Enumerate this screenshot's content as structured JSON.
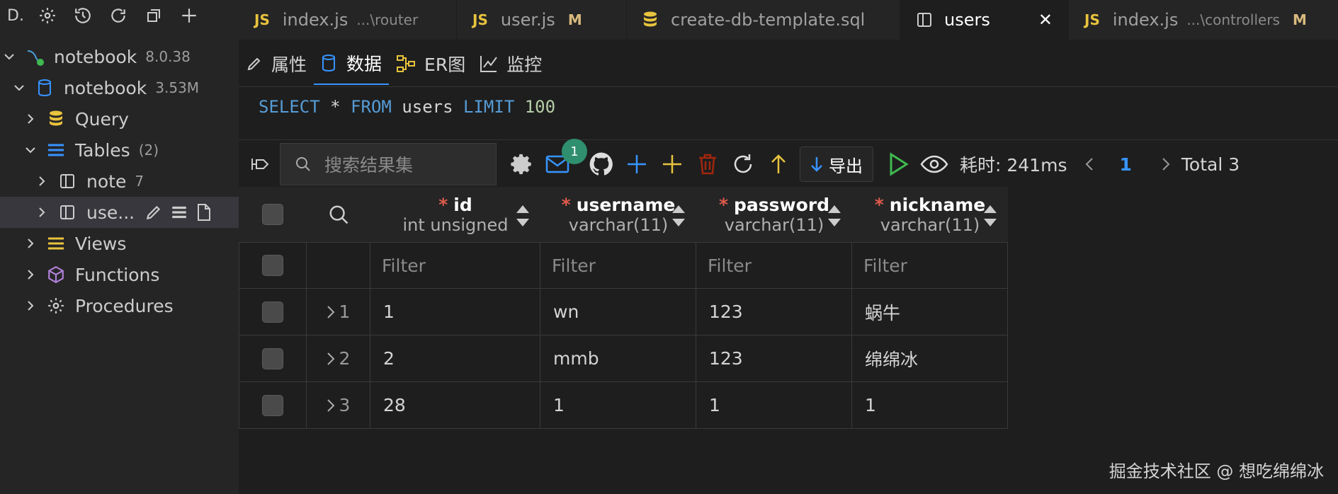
{
  "sidebar": {
    "title_abbrev": "D...",
    "tree": [
      {
        "label": "notebook",
        "meta": "8.0.38",
        "level": 0
      },
      {
        "label": "notebook",
        "meta": "3.53M",
        "level": 1
      },
      {
        "label": "Query",
        "meta": "",
        "level": 2
      },
      {
        "label": "Tables",
        "meta": "(2)",
        "level": 2
      },
      {
        "label": "note",
        "meta": "7",
        "level": 3
      },
      {
        "label": "use...",
        "meta": "",
        "level": 3
      },
      {
        "label": "Views",
        "meta": "",
        "level": 2
      },
      {
        "label": "Functions",
        "meta": "",
        "level": 2
      },
      {
        "label": "Procedures",
        "meta": "",
        "level": 2
      }
    ]
  },
  "tabs": [
    {
      "prefix": "JS",
      "label": "index.js",
      "desc": "...\\router",
      "mod": ""
    },
    {
      "prefix": "JS",
      "label": "user.js",
      "desc": "",
      "mod": "M"
    },
    {
      "prefix": "",
      "label": "create-db-template.sql",
      "desc": "",
      "mod": ""
    },
    {
      "prefix": "",
      "label": "users",
      "desc": "",
      "mod": "",
      "close": "✕"
    },
    {
      "prefix": "JS",
      "label": "index.js",
      "desc": "...\\controllers",
      "mod": "M"
    }
  ],
  "subtabs": [
    "属性",
    "数据",
    "ER图",
    "监控"
  ],
  "sql": {
    "kw1": "SELECT",
    "star": "*",
    "kw2": "FROM",
    "table": "users",
    "kw3": "LIMIT",
    "limit": "100"
  },
  "toolbar": {
    "search_placeholder": "搜索结果集",
    "badge_count": "1",
    "export_label": "导出",
    "elapsed": "耗时: 241ms",
    "page": "1",
    "total": "Total 3"
  },
  "columns": [
    {
      "name": "id",
      "type": "int unsigned"
    },
    {
      "name": "username",
      "type": "varchar(11)"
    },
    {
      "name": "password",
      "type": "varchar(11)"
    },
    {
      "name": "nickname",
      "type": "varchar(11)"
    }
  ],
  "required_mark": "*",
  "filter_placeholder": "Filter",
  "rows": [
    {
      "rownum": "1",
      "cells": [
        "1",
        "wn",
        "123",
        "蜗牛"
      ]
    },
    {
      "rownum": "2",
      "cells": [
        "2",
        "mmb",
        "123",
        "绵绵冰"
      ]
    },
    {
      "rownum": "3",
      "cells": [
        "28",
        "1",
        "1",
        "1"
      ]
    }
  ],
  "watermark": "掘金技术社区 @ 想吃绵绵冰",
  "colors": {
    "accent": "#3794ff",
    "js": "#e8c33d",
    "run": "#3fb950",
    "add": "#3794ff",
    "add_yellow": "#e8c33d",
    "delete": "#a1260d",
    "badge": "#2f8f6e"
  }
}
